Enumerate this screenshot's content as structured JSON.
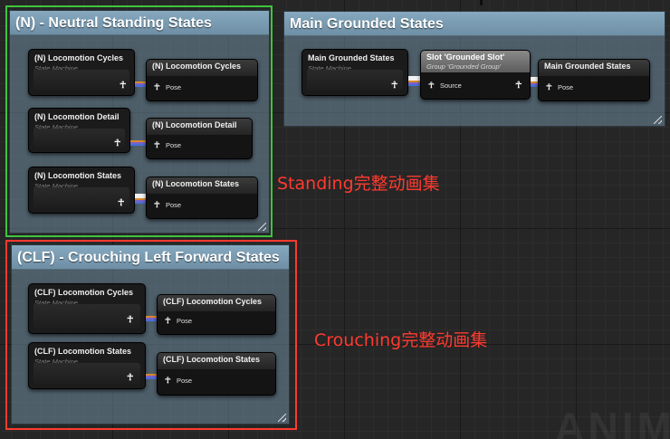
{
  "comments": {
    "neutral": {
      "title": "(N) - Neutral Standing States"
    },
    "main": {
      "title": "Main Grounded States"
    },
    "crouch": {
      "title": "(CLF) - Crouching Left Forward States"
    }
  },
  "nodes": {
    "n_cycles_sm": {
      "title": "(N) Locomotion Cycles",
      "subtitle": "State Machine"
    },
    "n_cycles_out": {
      "title": "(N) Locomotion Cycles",
      "pin": "Pose"
    },
    "n_detail_sm": {
      "title": "(N) Locomotion Detail",
      "subtitle": "State Machine"
    },
    "n_detail_out": {
      "title": "(N) Locomotion Detail",
      "pin": "Pose"
    },
    "n_states_sm": {
      "title": "(N) Locomotion States",
      "subtitle": "State Machine"
    },
    "n_states_out": {
      "title": "(N) Locomotion States",
      "pin": "Pose"
    },
    "main_sm": {
      "title": "Main Grounded States",
      "subtitle": "State Machine"
    },
    "slot": {
      "title": "Slot 'Grounded Slot'",
      "subtitle": "Group 'Grounded Group'",
      "pin": "Source"
    },
    "main_out": {
      "title": "Main Grounded States",
      "pin": "Pose"
    },
    "clf_cycles_sm": {
      "title": "(CLF) Locomotion Cycles",
      "subtitle": "State Machine"
    },
    "clf_cycles_out": {
      "title": "(CLF) Locomotion Cycles",
      "pin": "Pose"
    },
    "clf_states_sm": {
      "title": "(CLF) Locomotion States",
      "subtitle": "State Machine"
    },
    "clf_states_out": {
      "title": "(CLF) Locomotion States",
      "pin": "Pose"
    }
  },
  "annotations": {
    "standing": "Standing完整动画集",
    "crouching": "Crouching完整动画集"
  },
  "watermark": "ANIM",
  "icons": {
    "pose_pin": "pose-person-icon"
  },
  "colors": {
    "highlight_green": "#3fc43f",
    "highlight_red": "#ff3a2e",
    "comment_header": "#7c9db3",
    "annotation_text": "#ff3a2e"
  }
}
